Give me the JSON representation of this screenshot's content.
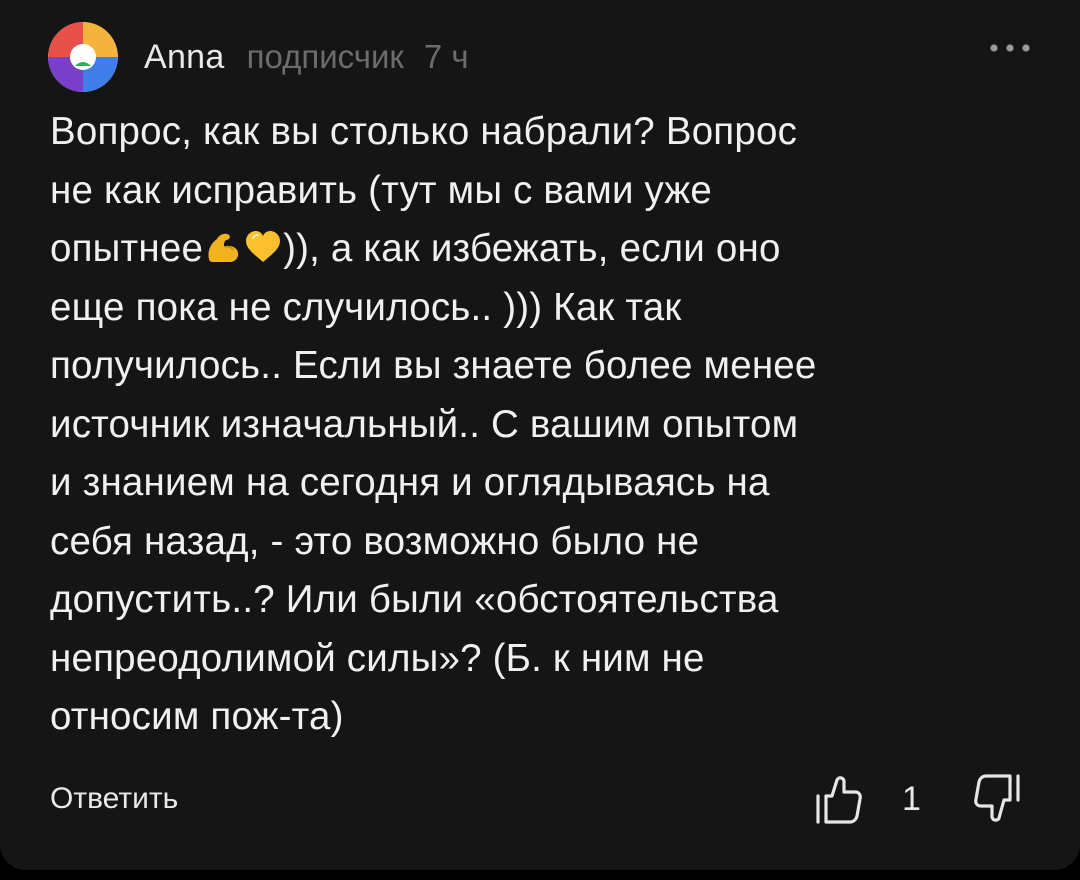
{
  "comment": {
    "author": "Anna",
    "role": "подписчик",
    "time": "7 ч",
    "lines": [
      "Вопрос, как вы столько набрали? Вопрос",
      "не как исправить (тут мы с вами уже",
      "опытнее",
      ")), а как избежать, если оно",
      "еще пока не случилось.. ))) Как так",
      "получилось.. Если вы знаете более менее",
      "источник изначальный.. С вашим опытом",
      "и знанием на сегодня и оглядываясь на",
      "себя назад, -  это возможно было не",
      "допустить..? Или были «обстоятельства",
      "непреодолимой силы»? (Б. к ним не",
      "относим пож-та)"
    ],
    "emojis": [
      "💪",
      "💛"
    ],
    "reply_label": "Ответить",
    "like_count": "1"
  },
  "colors": {
    "background": "#151515",
    "text": "#f0f0f0",
    "muted": "#6c6c6c"
  },
  "icons": {
    "avatar": "avatar",
    "more": "more-dots-icon",
    "like": "thumbs-up-icon",
    "dislike": "thumbs-down-icon",
    "emoji_1": "flexed-biceps-icon",
    "emoji_2": "yellow-heart-icon"
  }
}
